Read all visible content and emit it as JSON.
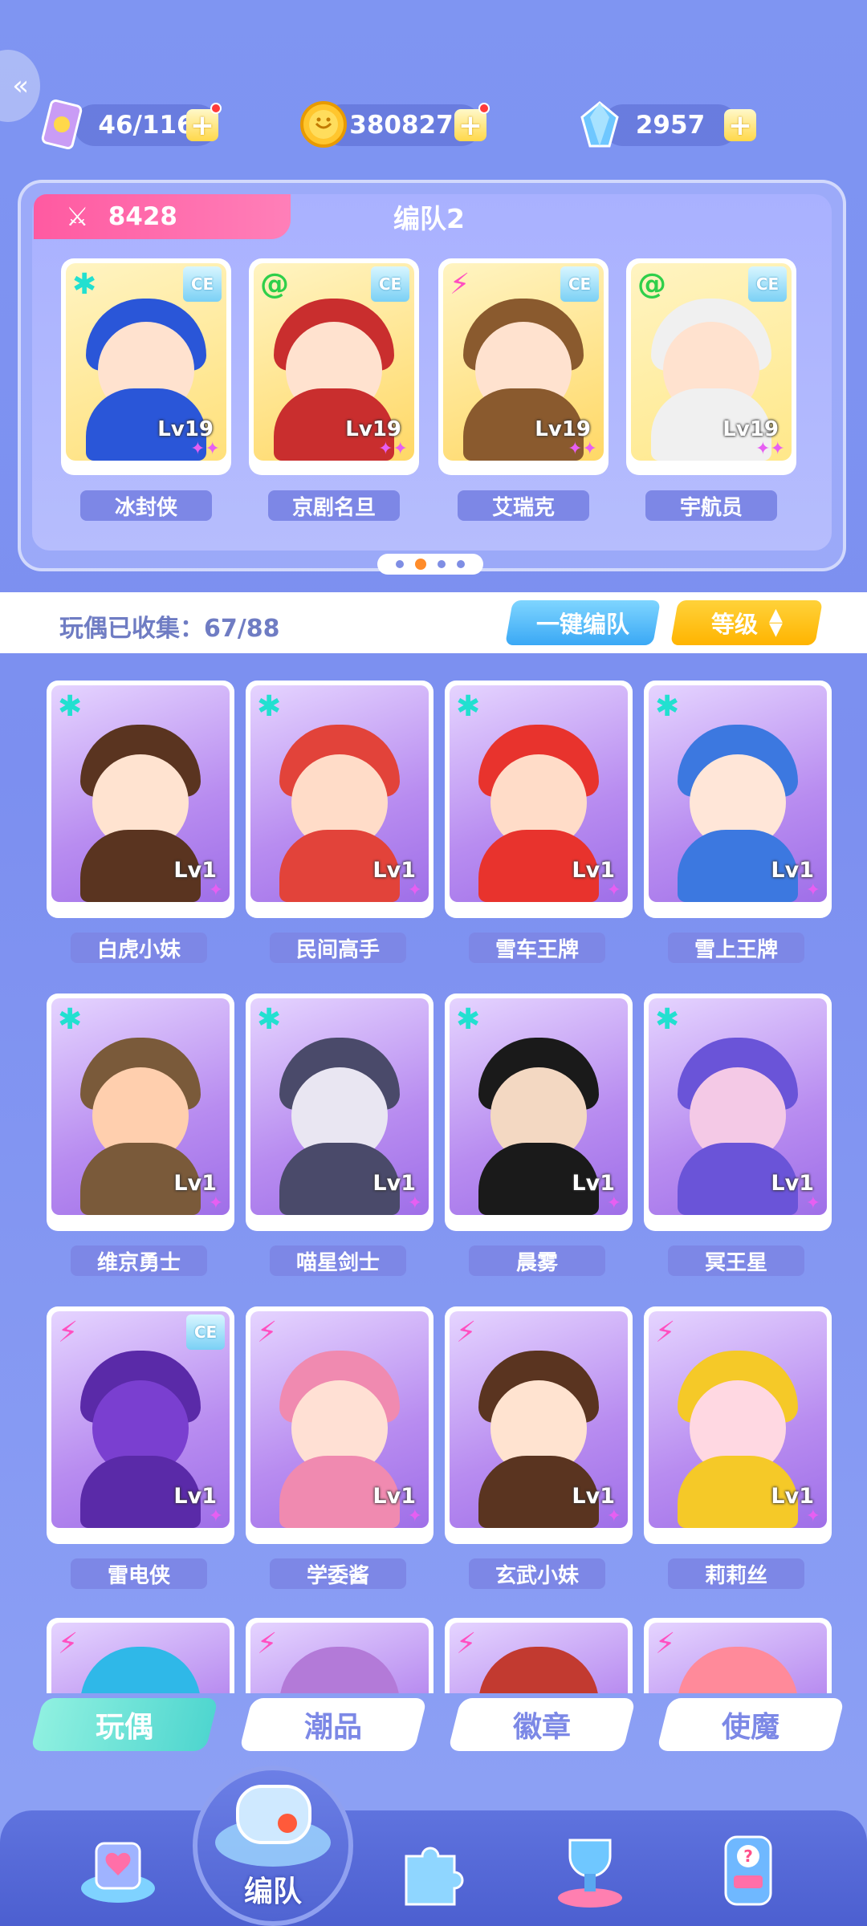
{
  "resources": {
    "stamina": {
      "value": "46/116",
      "icon": "stamina-card-icon"
    },
    "coins": {
      "value": "380827",
      "icon": "coin-icon"
    },
    "gems": {
      "value": "2957",
      "icon": "crystal-gem-icon"
    },
    "plus": "+"
  },
  "team": {
    "power": "8428",
    "name": "编队2",
    "members": [
      {
        "name": "冰封侠",
        "level": "Lv19",
        "element": "✱",
        "element_color": "#22e0d0",
        "badge": "CE",
        "bg": "#ffe07a",
        "accent": "#2a56d8"
      },
      {
        "name": "京剧名旦",
        "level": "Lv19",
        "element": "@",
        "element_color": "#2fcf4a",
        "badge": "CE",
        "bg": "#ffd866",
        "accent": "#c92e2e"
      },
      {
        "name": "艾瑞克",
        "level": "Lv19",
        "element": "⚡",
        "element_color": "#ff4fc0",
        "badge": "CE",
        "bg": "#ffd866",
        "accent": "#8a5a2e"
      },
      {
        "name": "宇航员",
        "level": "Lv19",
        "element": "@",
        "element_color": "#2fcf4a",
        "badge": "CE",
        "bg": "#ffe88a",
        "accent": "#f0f0f0"
      }
    ],
    "page_count": 4,
    "active_page": 2
  },
  "collection": {
    "label": "玩偶已收集：67/88",
    "auto_team": "一键编队",
    "sort": "等级",
    "sort_icon": "sort-arrows-icon"
  },
  "dolls": [
    {
      "name": "白虎小妹",
      "level": "Lv1",
      "element": "✱",
      "element_color": "#22e0d0",
      "skin": "#ffe3d0",
      "hair": "#5a3420"
    },
    {
      "name": "民间高手",
      "level": "Lv1",
      "element": "✱",
      "element_color": "#22e0d0",
      "skin": "#ffdcc8",
      "hair": "#e2433a"
    },
    {
      "name": "雪车王牌",
      "level": "Lv1",
      "element": "✱",
      "element_color": "#22e0d0",
      "skin": "#ffdcc8",
      "hair": "#e8332d"
    },
    {
      "name": "雪上王牌",
      "level": "Lv1",
      "element": "✱",
      "element_color": "#22e0d0",
      "skin": "#ffe6d8",
      "hair": "#3c78e0"
    },
    {
      "name": "维京勇士",
      "level": "Lv1",
      "element": "✱",
      "element_color": "#22e0d0",
      "skin": "#ffcfae",
      "hair": "#7a5a3a"
    },
    {
      "name": "喵星剑士",
      "level": "Lv1",
      "element": "✱",
      "element_color": "#22e0d0",
      "skin": "#e9e6f2",
      "hair": "#4a4a6a"
    },
    {
      "name": "晨雾",
      "level": "Lv1",
      "element": "✱",
      "element_color": "#22e0d0",
      "skin": "#f3d8c2",
      "hair": "#1a1a1a"
    },
    {
      "name": "冥王星",
      "level": "Lv1",
      "element": "✱",
      "element_color": "#22e0d0",
      "skin": "#f4c9e6",
      "hair": "#6a54d8"
    },
    {
      "name": "雷电侠",
      "level": "Lv1",
      "element": "⚡",
      "element_color": "#ff4fc0",
      "skin": "#7a3fd0",
      "hair": "#5a2aa8",
      "badge": "CE"
    },
    {
      "name": "学委酱",
      "level": "Lv1",
      "element": "⚡",
      "element_color": "#ff4fc0",
      "skin": "#ffe0d4",
      "hair": "#f08ab0"
    },
    {
      "name": "玄武小妹",
      "level": "Lv1",
      "element": "⚡",
      "element_color": "#ff4fc0",
      "skin": "#ffe3d0",
      "hair": "#5a3420"
    },
    {
      "name": "莉莉丝",
      "level": "Lv1",
      "element": "⚡",
      "element_color": "#ff4fc0",
      "skin": "#ffd8e2",
      "hair": "#f5c928"
    }
  ],
  "partial_row": [
    {
      "element": "⚡",
      "element_color": "#ff4fc0",
      "accent": "#2fb8e8"
    },
    {
      "element": "⚡",
      "element_color": "#ff4fc0",
      "accent": "#b37ad8"
    },
    {
      "element": "⚡",
      "element_color": "#ff4fc0",
      "accent": "#c23a30"
    },
    {
      "element": "⚡",
      "element_color": "#ff4fc0",
      "accent": "#ff8a9a"
    }
  ],
  "category_tabs": [
    {
      "label": "玩偶",
      "active": true
    },
    {
      "label": "潮品",
      "active": false
    },
    {
      "label": "徽章",
      "active": false
    },
    {
      "label": "使魔",
      "active": false
    }
  ],
  "bottom_nav": {
    "center_label": "编队",
    "items": [
      "heart-arrow-icon",
      "whistle-icon",
      "puzzle-icon",
      "trophy-icon",
      "mystery-machine-icon"
    ]
  },
  "colors": {
    "background": "#7f95f2",
    "power_tag": "#ff5aa1",
    "auto_team_button": "#3aa8f5",
    "sort_button": "#ffb400",
    "active_tab": "#4fd6cf"
  }
}
